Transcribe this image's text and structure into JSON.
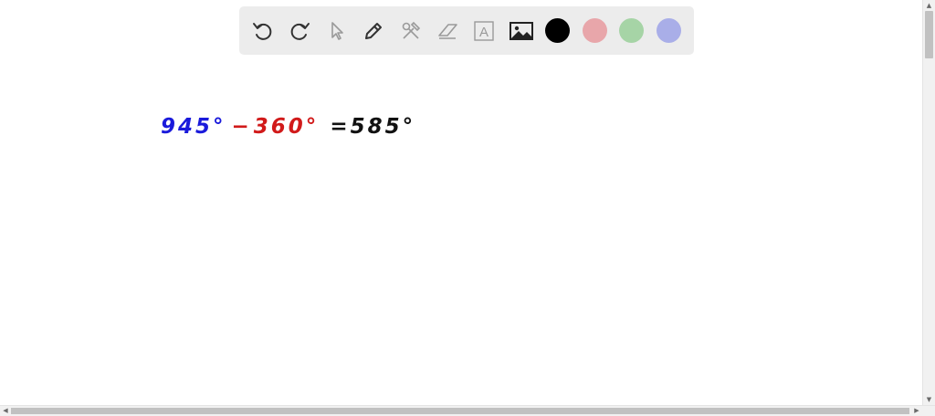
{
  "toolbar": {
    "tools": [
      {
        "name": "undo-icon"
      },
      {
        "name": "redo-icon"
      },
      {
        "name": "pointer-icon"
      },
      {
        "name": "pen-icon"
      },
      {
        "name": "tools-icon"
      },
      {
        "name": "eraser-icon"
      },
      {
        "name": "text-icon",
        "glyph": "A"
      },
      {
        "name": "image-icon"
      }
    ],
    "colors": {
      "black": "#000000",
      "red": "#e8a6aa",
      "green": "#a6d4a6",
      "blue": "#a9aee8"
    }
  },
  "canvas": {
    "expression": {
      "term1": "945°",
      "minus": "−",
      "term2": "360°",
      "equals_result": "=585°"
    },
    "ink_colors": {
      "term1": "#1a1adb",
      "term2": "#d11a1a",
      "result": "#111111"
    }
  },
  "scrollbars": {
    "up_arrow": "▲",
    "down_arrow": "▼",
    "left_arrow": "◀",
    "right_arrow": "▶"
  }
}
